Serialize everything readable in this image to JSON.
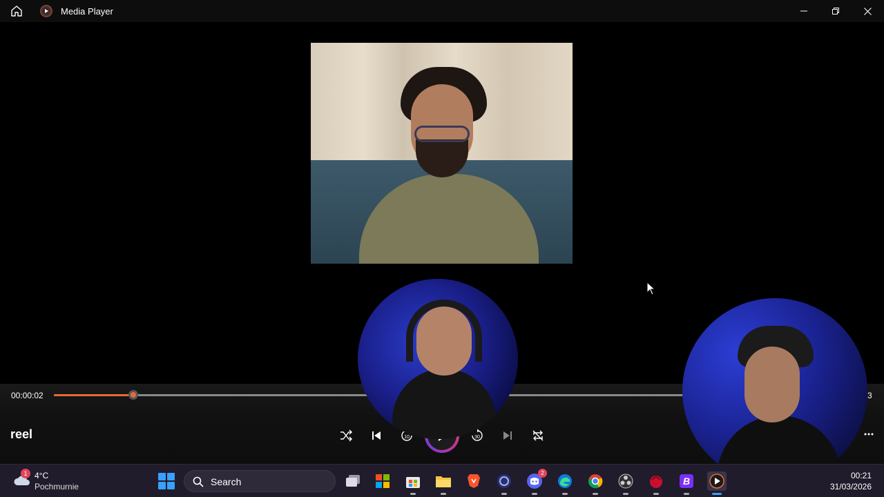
{
  "window": {
    "title": "Media Player",
    "home_icon": "home-icon",
    "app_icon": "media-player-icon",
    "controls": [
      "minimize-icon",
      "restore-icon",
      "close-icon"
    ]
  },
  "player": {
    "time_current": "00:00:02",
    "time_end_visible": "3",
    "progress_fraction": 0.098,
    "track_title": "reel",
    "controls": [
      "shuffle-icon",
      "previous-icon",
      "rewind-10-icon",
      "play-icon",
      "forward-30-icon",
      "next-icon",
      "repeat-off-icon"
    ],
    "rewind_label": "10",
    "forward_label": "30",
    "more_icon": "more-options-icon"
  },
  "taskbar": {
    "weather": {
      "temp": "4°C",
      "description": "Pochmurnie",
      "badge": "1"
    },
    "search_label": "Search",
    "apps": [
      {
        "name": "task-view",
        "badge": ""
      },
      {
        "name": "microsoft-store-grid",
        "badge": ""
      },
      {
        "name": "microsoft-store",
        "badge": ""
      },
      {
        "name": "file-explorer",
        "badge": ""
      },
      {
        "name": "brave",
        "badge": ""
      },
      {
        "name": "cortana-circle",
        "badge": ""
      },
      {
        "name": "discord",
        "badge": "2"
      },
      {
        "name": "edge",
        "badge": ""
      },
      {
        "name": "chrome",
        "badge": "●"
      },
      {
        "name": "obs",
        "badge": "●"
      },
      {
        "name": "red-app",
        "badge": "●"
      },
      {
        "name": "b-app",
        "badge": ""
      },
      {
        "name": "media-player",
        "badge": ""
      }
    ],
    "clock": {
      "time": "00:21",
      "date": "31/03/2026"
    }
  },
  "colors": {
    "accent": "#e8693a",
    "taskbar_bg": "#201c2c"
  }
}
